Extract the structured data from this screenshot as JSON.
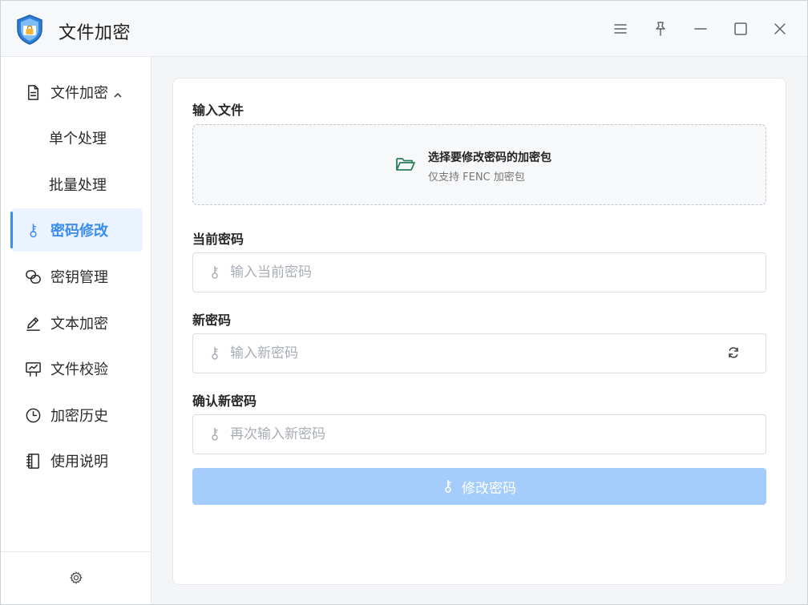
{
  "app": {
    "title": "文件加密"
  },
  "sidebar": {
    "items": [
      {
        "label": "文件加密",
        "icon": "document-icon"
      },
      {
        "label": "单个处理"
      },
      {
        "label": "批量处理"
      },
      {
        "label": "密码修改",
        "icon": "key-icon",
        "active": true
      },
      {
        "label": "密钥管理",
        "icon": "link-icon"
      },
      {
        "label": "文本加密",
        "icon": "pen-icon"
      },
      {
        "label": "文件校验",
        "icon": "presentation-icon"
      },
      {
        "label": "加密历史",
        "icon": "clock-icon"
      },
      {
        "label": "使用说明",
        "icon": "notebook-icon"
      }
    ]
  },
  "main": {
    "input_file_label": "输入文件",
    "dropzone_title": "选择要修改密码的加密包",
    "dropzone_subtitle": "仅支持 FENC 加密包",
    "current_password_label": "当前密码",
    "current_password_placeholder": "输入当前密码",
    "new_password_label": "新密码",
    "new_password_placeholder": "输入新密码",
    "confirm_password_label": "确认新密码",
    "confirm_password_placeholder": "再次输入新密码",
    "submit_label": "修改密码"
  },
  "colors": {
    "accent": "#3b8ef0",
    "active_bg": "#eaf3ff",
    "button_disabled": "#a5cdfb",
    "folder_icon": "#2e7d5b"
  }
}
